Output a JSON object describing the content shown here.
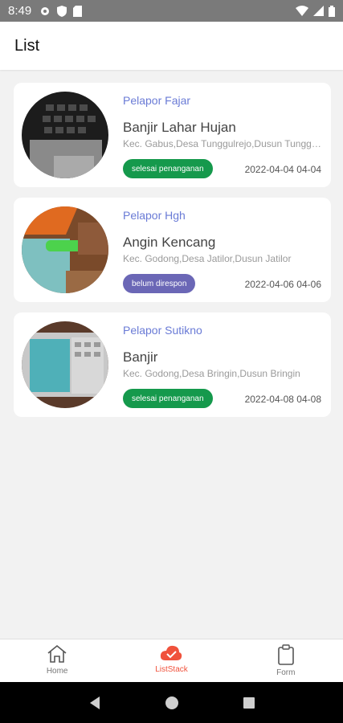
{
  "status": {
    "time": "8:49"
  },
  "header": {
    "title": "List"
  },
  "reports": [
    {
      "reporter": "Pelapor Fajar",
      "title": "Banjir Lahar Hujan",
      "address": "Kec. Gabus,Desa Tunggulrejo,Dusun Tunggulrejo",
      "status": "selesai penanganan",
      "date": "2022-04-04 04-04"
    },
    {
      "reporter": "Pelapor Hgh",
      "title": "Angin Kencang",
      "address": "Kec. Godong,Desa Jatilor,Dusun Jatilor",
      "status": "belum direspon",
      "date": "2022-04-06 04-06"
    },
    {
      "reporter": "Pelapor Sutikno",
      "title": "Banjir",
      "address": "Kec. Godong,Desa Bringin,Dusun Bringin",
      "status": "selesai penanganan",
      "date": "2022-04-08 04-08"
    }
  ],
  "nav": {
    "home": "Home",
    "liststack": "ListStack",
    "form": "Form"
  },
  "colors": {
    "done": "#15994c",
    "pending": "#6b67b6",
    "accent": "#f0523c",
    "reporter": "#6a7bd6"
  }
}
